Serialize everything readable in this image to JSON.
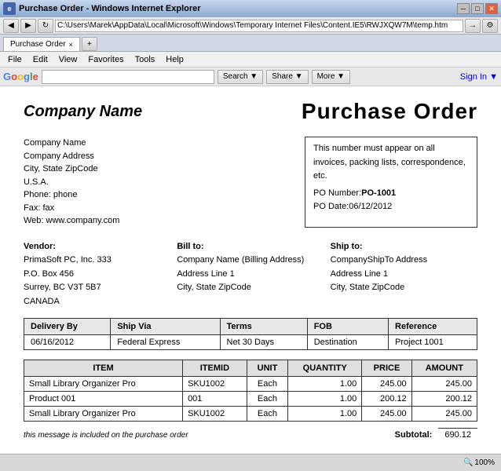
{
  "window": {
    "title": "Purchase Order - Windows Internet Explorer",
    "address": "C:\\Users\\Marek\\AppData\\Local\\Microsoft\\Windows\\Temporary Internet Files\\Content.IE5\\RWJXQW7M\\temp.htm",
    "tab_label": "Purchase Order",
    "tab_close": "×"
  },
  "menu": {
    "items": [
      "File",
      "Edit",
      "View",
      "Favorites",
      "Tools",
      "Help"
    ]
  },
  "google_bar": {
    "logo": "Google",
    "search_placeholder": "",
    "search_btn": "Search ▼",
    "share_btn": "Share ▼",
    "more_btn": "More ▼",
    "signin": "Sign In ▼"
  },
  "document": {
    "company_name": "Company Name",
    "po_title": "Purchase Order",
    "company_address_lines": [
      "Company Name",
      "Company Address",
      "City, State ZipCode",
      "U.S.A.",
      "Phone: phone",
      "Fax: fax",
      "Web: www.company.com"
    ],
    "po_box_note": "This number must appear on all invoices, packing lists, correspondence, etc.",
    "po_number_label": "PO Number:",
    "po_number_value": "PO-1001",
    "po_date_label": "PO Date:",
    "po_date_value": "06/12/2012"
  },
  "vendor": {
    "label": "Vendor:",
    "lines": [
      "PrimaSoft PC, Inc. 333",
      "P.O. Box 456",
      "Surrey, BC V3T 5B7",
      "CANADA"
    ]
  },
  "bill_to": {
    "label": "Bill to:",
    "lines": [
      "Company Name (Billing Address)",
      "Address Line 1",
      "City, State ZipCode"
    ]
  },
  "ship_to": {
    "label": "Ship to:",
    "lines": [
      "CompanyShipTo Address",
      "Address Line 1",
      "City, State ZipCode"
    ]
  },
  "delivery": {
    "headers": [
      "Delivery By",
      "Ship Via",
      "Terms",
      "FOB",
      "Reference"
    ],
    "row": [
      "06/16/2012",
      "Federal Express",
      "Net 30 Days",
      "Destination",
      "Project 1001"
    ]
  },
  "items": {
    "headers": [
      "ITEM",
      "ITEMID",
      "UNIT",
      "QUANTITY",
      "PRICE",
      "AMOUNT"
    ],
    "rows": [
      [
        "Small Library Organizer Pro",
        "SKU1002",
        "Each",
        "1.00",
        "245.00",
        "245.00"
      ],
      [
        "Product 001",
        "001",
        "Each",
        "1.00",
        "200.12",
        "200.12"
      ],
      [
        "Small Library Organizer Pro",
        "SKU1002",
        "Each",
        "1.00",
        "245.00",
        "245.00"
      ]
    ]
  },
  "totals": {
    "subtotal_label": "Subtotal:",
    "subtotal_value": "690.12"
  },
  "message": "this message is included on the purchase order",
  "status_bar": {
    "zoom": "100%"
  }
}
